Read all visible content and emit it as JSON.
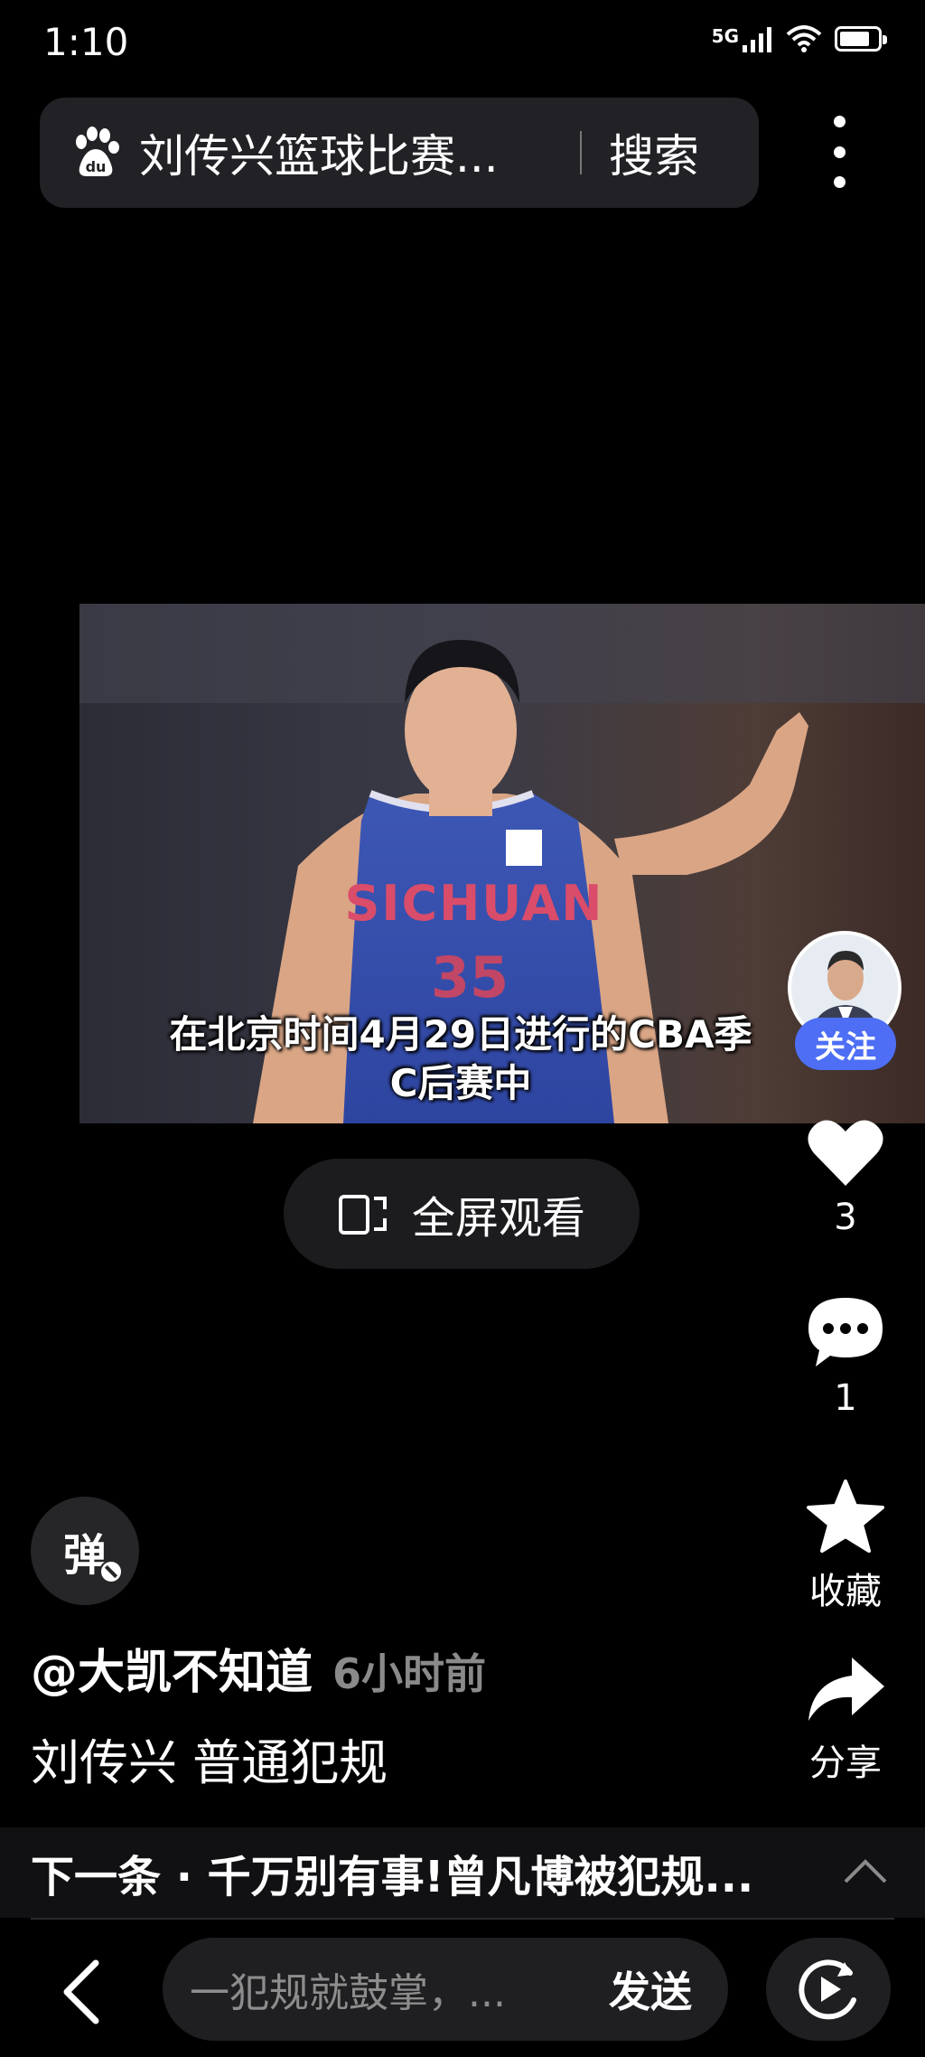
{
  "status_bar": {
    "time": "1:10",
    "network": "5G",
    "icons": [
      "signal-icon",
      "wifi-icon",
      "battery-icon"
    ],
    "battery_level": 0.8
  },
  "search_bar": {
    "query": "刘传兴篮球比赛...",
    "search_label": "搜索",
    "logo_icon": "baidu-paw-icon"
  },
  "video": {
    "subtitle_line1": "在北京时间4月29日进行的CBA季",
    "subtitle_line2": "C后赛中"
  },
  "follow_label": "关注",
  "fullscreen_label": "全屏观看",
  "actions": {
    "like_count": "3",
    "comment_count": "1",
    "favorite_label": "收藏",
    "share_label": "分享"
  },
  "danmaku_label": "弹",
  "post": {
    "author": "@大凯不知道",
    "time": "6小时前",
    "title": "刘传兴 普通犯规"
  },
  "next": {
    "text": "下一条 · 千万别有事!曾凡博被犯规..."
  },
  "bottom_bar": {
    "comment_placeholder": "一犯规就鼓掌，...",
    "send_label": "发送"
  },
  "colors": {
    "background": "#000000",
    "follow_button": "#4d6ef5",
    "pill_background": "#1f1f22"
  }
}
